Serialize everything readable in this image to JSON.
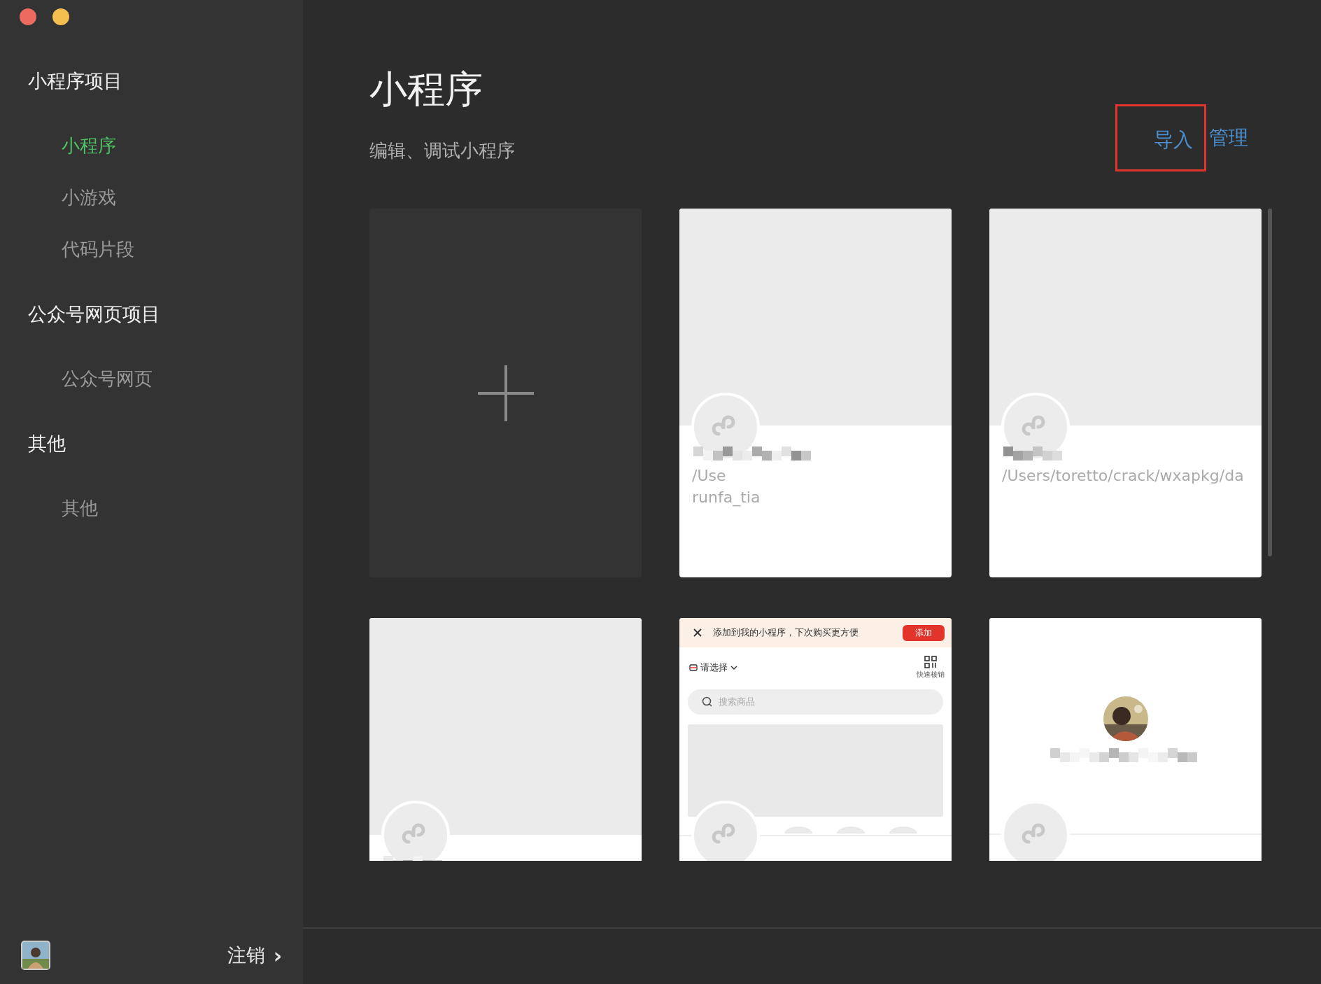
{
  "window": {
    "controls": [
      {
        "color": "#ed6a5e"
      },
      {
        "color": "#f5bf4f"
      }
    ]
  },
  "sidebar": {
    "sections": [
      {
        "title": "小程序项目",
        "items": [
          {
            "label": "小程序",
            "selected": true
          },
          {
            "label": "小游戏",
            "selected": false
          },
          {
            "label": "代码片段",
            "selected": false
          }
        ]
      },
      {
        "title": "公众号网页项目",
        "items": [
          {
            "label": "公众号网页",
            "selected": false
          }
        ]
      },
      {
        "title": "其他",
        "items": [
          {
            "label": "其他",
            "selected": false
          }
        ]
      }
    ]
  },
  "account": {
    "logout": "注销",
    "arrow": "›"
  },
  "header": {
    "title": "小程序",
    "subtitle": "编辑、调试小程序",
    "actions": [
      {
        "label": "导入",
        "highlighted": true
      },
      {
        "label": "管理",
        "highlighted": false
      }
    ]
  },
  "projects": [
    {
      "kind": "new"
    },
    {
      "kind": "project",
      "path_lines": [
        "/Use",
        "runfa_tia"
      ]
    },
    {
      "kind": "project",
      "path_lines": [
        "/Users/toretto/crack/wxapkg/da"
      ]
    },
    {
      "kind": "project"
    },
    {
      "kind": "preview",
      "banner": "添加到我的小程序，下次购买更方便",
      "banner_button": "添加",
      "store_select": "请选择",
      "scan_label": "快速核销",
      "search_placeholder": "搜索商品"
    },
    {
      "kind": "avatar"
    }
  ]
}
